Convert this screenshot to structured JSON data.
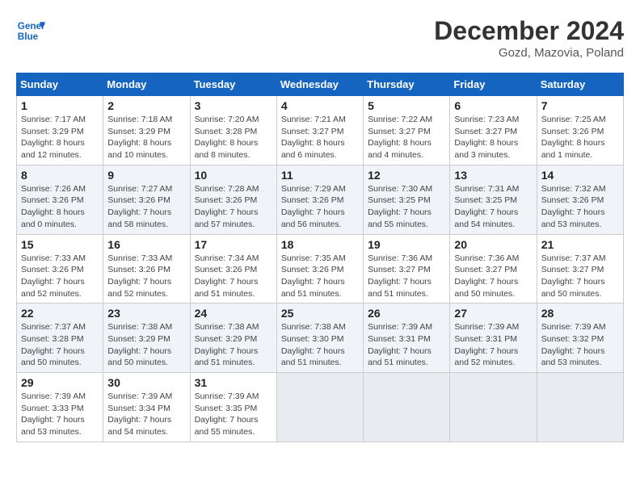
{
  "header": {
    "logo_line1": "General",
    "logo_line2": "Blue",
    "title": "December 2024",
    "subtitle": "Gozd, Mazovia, Poland"
  },
  "days_of_week": [
    "Sunday",
    "Monday",
    "Tuesday",
    "Wednesday",
    "Thursday",
    "Friday",
    "Saturday"
  ],
  "weeks": [
    [
      {
        "day": "1",
        "info": "Sunrise: 7:17 AM\nSunset: 3:29 PM\nDaylight: 8 hours and 12 minutes."
      },
      {
        "day": "2",
        "info": "Sunrise: 7:18 AM\nSunset: 3:29 PM\nDaylight: 8 hours and 10 minutes."
      },
      {
        "day": "3",
        "info": "Sunrise: 7:20 AM\nSunset: 3:28 PM\nDaylight: 8 hours and 8 minutes."
      },
      {
        "day": "4",
        "info": "Sunrise: 7:21 AM\nSunset: 3:27 PM\nDaylight: 8 hours and 6 minutes."
      },
      {
        "day": "5",
        "info": "Sunrise: 7:22 AM\nSunset: 3:27 PM\nDaylight: 8 hours and 4 minutes."
      },
      {
        "day": "6",
        "info": "Sunrise: 7:23 AM\nSunset: 3:27 PM\nDaylight: 8 hours and 3 minutes."
      },
      {
        "day": "7",
        "info": "Sunrise: 7:25 AM\nSunset: 3:26 PM\nDaylight: 8 hours and 1 minute."
      }
    ],
    [
      {
        "day": "8",
        "info": "Sunrise: 7:26 AM\nSunset: 3:26 PM\nDaylight: 8 hours and 0 minutes."
      },
      {
        "day": "9",
        "info": "Sunrise: 7:27 AM\nSunset: 3:26 PM\nDaylight: 7 hours and 58 minutes."
      },
      {
        "day": "10",
        "info": "Sunrise: 7:28 AM\nSunset: 3:26 PM\nDaylight: 7 hours and 57 minutes."
      },
      {
        "day": "11",
        "info": "Sunrise: 7:29 AM\nSunset: 3:26 PM\nDaylight: 7 hours and 56 minutes."
      },
      {
        "day": "12",
        "info": "Sunrise: 7:30 AM\nSunset: 3:25 PM\nDaylight: 7 hours and 55 minutes."
      },
      {
        "day": "13",
        "info": "Sunrise: 7:31 AM\nSunset: 3:25 PM\nDaylight: 7 hours and 54 minutes."
      },
      {
        "day": "14",
        "info": "Sunrise: 7:32 AM\nSunset: 3:26 PM\nDaylight: 7 hours and 53 minutes."
      }
    ],
    [
      {
        "day": "15",
        "info": "Sunrise: 7:33 AM\nSunset: 3:26 PM\nDaylight: 7 hours and 52 minutes."
      },
      {
        "day": "16",
        "info": "Sunrise: 7:33 AM\nSunset: 3:26 PM\nDaylight: 7 hours and 52 minutes."
      },
      {
        "day": "17",
        "info": "Sunrise: 7:34 AM\nSunset: 3:26 PM\nDaylight: 7 hours and 51 minutes."
      },
      {
        "day": "18",
        "info": "Sunrise: 7:35 AM\nSunset: 3:26 PM\nDaylight: 7 hours and 51 minutes."
      },
      {
        "day": "19",
        "info": "Sunrise: 7:36 AM\nSunset: 3:27 PM\nDaylight: 7 hours and 51 minutes."
      },
      {
        "day": "20",
        "info": "Sunrise: 7:36 AM\nSunset: 3:27 PM\nDaylight: 7 hours and 50 minutes."
      },
      {
        "day": "21",
        "info": "Sunrise: 7:37 AM\nSunset: 3:27 PM\nDaylight: 7 hours and 50 minutes."
      }
    ],
    [
      {
        "day": "22",
        "info": "Sunrise: 7:37 AM\nSunset: 3:28 PM\nDaylight: 7 hours and 50 minutes."
      },
      {
        "day": "23",
        "info": "Sunrise: 7:38 AM\nSunset: 3:29 PM\nDaylight: 7 hours and 50 minutes."
      },
      {
        "day": "24",
        "info": "Sunrise: 7:38 AM\nSunset: 3:29 PM\nDaylight: 7 hours and 51 minutes."
      },
      {
        "day": "25",
        "info": "Sunrise: 7:38 AM\nSunset: 3:30 PM\nDaylight: 7 hours and 51 minutes."
      },
      {
        "day": "26",
        "info": "Sunrise: 7:39 AM\nSunset: 3:31 PM\nDaylight: 7 hours and 51 minutes."
      },
      {
        "day": "27",
        "info": "Sunrise: 7:39 AM\nSunset: 3:31 PM\nDaylight: 7 hours and 52 minutes."
      },
      {
        "day": "28",
        "info": "Sunrise: 7:39 AM\nSunset: 3:32 PM\nDaylight: 7 hours and 53 minutes."
      }
    ],
    [
      {
        "day": "29",
        "info": "Sunrise: 7:39 AM\nSunset: 3:33 PM\nDaylight: 7 hours and 53 minutes."
      },
      {
        "day": "30",
        "info": "Sunrise: 7:39 AM\nSunset: 3:34 PM\nDaylight: 7 hours and 54 minutes."
      },
      {
        "day": "31",
        "info": "Sunrise: 7:39 AM\nSunset: 3:35 PM\nDaylight: 7 hours and 55 minutes."
      },
      {
        "day": "",
        "info": ""
      },
      {
        "day": "",
        "info": ""
      },
      {
        "day": "",
        "info": ""
      },
      {
        "day": "",
        "info": ""
      }
    ]
  ]
}
